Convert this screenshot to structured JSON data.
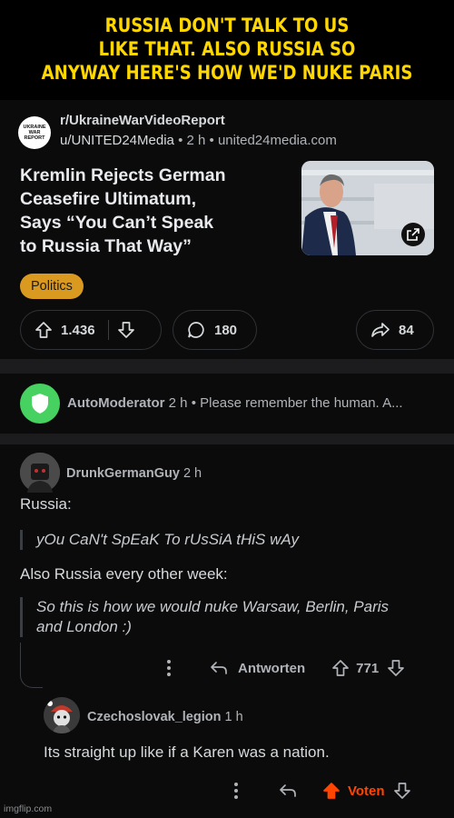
{
  "caption": "RUSSIA DON'T TALK TO US\nLIKE THAT. ALSO RUSSIA SO\nANYWAY HERE'S HOW WE'D NUKE PARIS",
  "post": {
    "subreddit_avatar_text": "UKRAINE WAR REPORT",
    "subreddit": "r/UkraineWarVideoReport",
    "user": "u/UNITED24Media",
    "time": "2 h",
    "domain": "united24media.com",
    "title": "Kremlin Rejects German\nCeasefire Ultimatum,\nSays “You Can’t Speak\nto Russia That Way”",
    "flair": "Politics",
    "flair_color": "#d99a1f",
    "upvotes": "1.436",
    "comments": "180",
    "shares": "84",
    "icons": [
      "upvote-icon",
      "downvote-icon",
      "comment-icon",
      "share-icon",
      "external-link-icon"
    ]
  },
  "automod": {
    "name": "AutoModerator",
    "time": "2 h",
    "snippet": "Please remember the human. A...",
    "avatar_color": "#46d160"
  },
  "comment": {
    "author": "DrunkGermanGuy",
    "time": "2 h",
    "line1": "Russia:",
    "quote1": "yOu CaN't SpEaK To rUsSiA tHiS wAy",
    "line2": "Also Russia every other week:",
    "quote2": "So this is how we would nuke Warsaw, Berlin, Paris\nand London :)",
    "reply_label": "Antworten",
    "votes": "771"
  },
  "reply": {
    "author": "Czechoslovak_legion",
    "time": "1 h",
    "text": "Its straight up like if a Karen was a nation.",
    "vote_label": "Voten",
    "upvote_color": "#ff4500"
  },
  "watermark": "imgflip.com"
}
